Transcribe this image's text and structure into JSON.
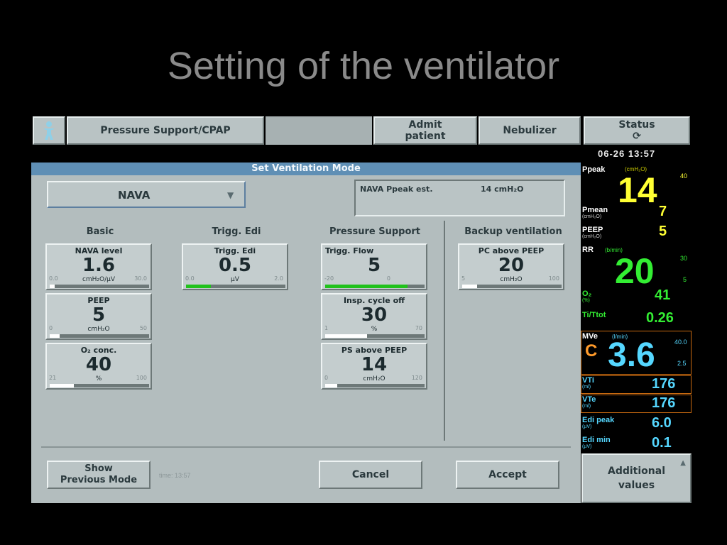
{
  "slide": {
    "title": "Setting of the ventilator"
  },
  "topbar": {
    "mode": "Pressure Support/CPAP",
    "admit": "Admit\npatient",
    "nebulizer": "Nebulizer",
    "status": "Status\n⟳"
  },
  "dialog": {
    "title": "Set Ventilation Mode",
    "mode_value": "NAVA",
    "ppeak_label": "NAVA Ppeak est.",
    "ppeak_value": "14 cmH₂O",
    "headers": {
      "basic": "Basic",
      "trigg_edi": "Trigg. Edi",
      "pressure_support": "Pressure Support",
      "backup": "Backup ventilation"
    },
    "knobs": {
      "nava_level": {
        "label": "NAVA level",
        "value": "1.6",
        "unit": "cmH₂O/µV",
        "min": "0.0",
        "max": "30.0",
        "fraction": 0.05
      },
      "peep": {
        "label": "PEEP",
        "value": "5",
        "unit": "cmH₂O",
        "min": "0",
        "max": "50",
        "fraction": 0.1
      },
      "o2": {
        "label": "O₂ conc.",
        "value": "40",
        "unit": "%",
        "min": "21",
        "max": "100",
        "fraction": 0.24
      },
      "trigg_edi": {
        "label": "Trigg. Edi",
        "value": "0.5",
        "unit": "µV",
        "min": "0.0",
        "max": "2.0",
        "fraction": 0.25
      },
      "trigg_flow": {
        "label": "Trigg. Flow",
        "value": "5",
        "unit": "",
        "min": "-20",
        "max": "0",
        "fraction": 0.83
      },
      "insp_cycle": {
        "label": "Insp. cycle off",
        "value": "30",
        "unit": "%",
        "min": "1",
        "max": "70",
        "fraction": 0.42
      },
      "ps_above": {
        "label": "PS above PEEP",
        "value": "14",
        "unit": "cmH₂O",
        "min": "0",
        "max": "120",
        "fraction": 0.12
      },
      "pc_above": {
        "label": "PC above PEEP",
        "value": "20",
        "unit": "cmH₂O",
        "min": "5",
        "max": "100",
        "fraction": 0.15
      }
    },
    "show_prev": "Show\nPrevious Mode",
    "time_note": "time: 13:57",
    "cancel": "Cancel",
    "accept": "Accept"
  },
  "monitor": {
    "clock": "06-26   13:57",
    "ppeak": {
      "label": "Ppeak",
      "unit": "(cmH₂O)",
      "value": "14",
      "limit_high": "40"
    },
    "pmean": {
      "label": "Pmean",
      "unit": "(cmH₂O)",
      "value": "7"
    },
    "peep": {
      "label": "PEEP",
      "unit": "(cmH₂O)",
      "value": "5"
    },
    "rr": {
      "label": "RR",
      "unit": "(b/min)",
      "value": "20",
      "limit_high": "30",
      "limit_low": "5"
    },
    "o2": {
      "label": "O₂",
      "unit": "(%)",
      "value": "41"
    },
    "titot": {
      "label": "Ti/Ttot",
      "value": "0.26"
    },
    "mve": {
      "label": "MVe",
      "unit": "(l/min)",
      "value": "3.6",
      "prefix": "C",
      "limit_high": "40.0",
      "limit_low": "2.5"
    },
    "vti": {
      "label": "VTi",
      "unit": "(ml)",
      "value": "176"
    },
    "vte": {
      "label": "VTe",
      "unit": "(ml)",
      "value": "176"
    },
    "edi_peak": {
      "label": "Edi peak",
      "unit": "(µV)",
      "value": "6.0"
    },
    "edi_min": {
      "label": "Edi min",
      "unit": "(µV)",
      "value": "0.1"
    }
  },
  "additional": "Additional\nvalues",
  "colors": {
    "accent_title_bar": "#5f8fb5",
    "panel_yellow": "#ffff33",
    "panel_green": "#33ee33",
    "panel_cyan": "#55d7ff"
  }
}
